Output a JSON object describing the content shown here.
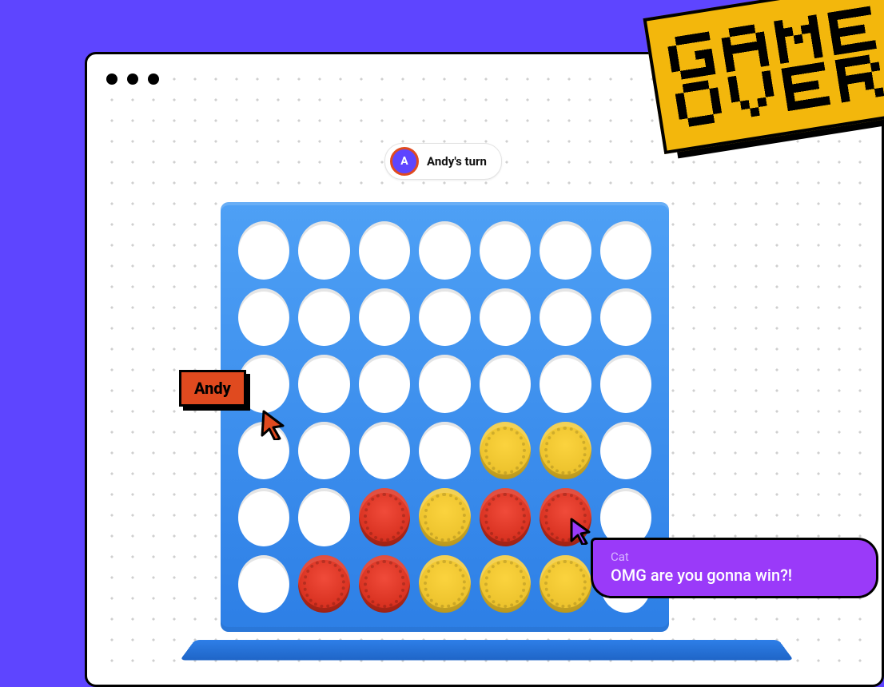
{
  "turn": {
    "avatar_letter": "A",
    "text": "Andy's turn"
  },
  "players": {
    "andy": {
      "label": "Andy",
      "color": "#E04A1F"
    },
    "cat": {
      "name": "Cat",
      "message": "OMG are you gonna win?!"
    }
  },
  "banner": {
    "line1": "GAME",
    "line2": "OVER"
  },
  "board": {
    "columns": 7,
    "rows": 6,
    "legend": {
      "R": "red",
      "Y": "yellow",
      ".": "empty"
    },
    "grid": [
      [
        ".",
        ".",
        ".",
        ".",
        ".",
        ".",
        "."
      ],
      [
        ".",
        ".",
        ".",
        ".",
        ".",
        ".",
        "."
      ],
      [
        ".",
        ".",
        ".",
        ".",
        ".",
        ".",
        "."
      ],
      [
        ".",
        ".",
        ".",
        ".",
        "Y",
        "Y",
        "."
      ],
      [
        ".",
        ".",
        "R",
        "Y",
        "R",
        "R",
        "."
      ],
      [
        ".",
        "R",
        "R",
        "Y",
        "Y",
        "Y",
        "."
      ]
    ]
  },
  "colors": {
    "accent": "#5E45FF",
    "board": "#2D7FE6",
    "red": "#D7301F",
    "yellow": "#ECC22C",
    "banner": "#F3B70C",
    "chat": "#9A3AF9"
  }
}
